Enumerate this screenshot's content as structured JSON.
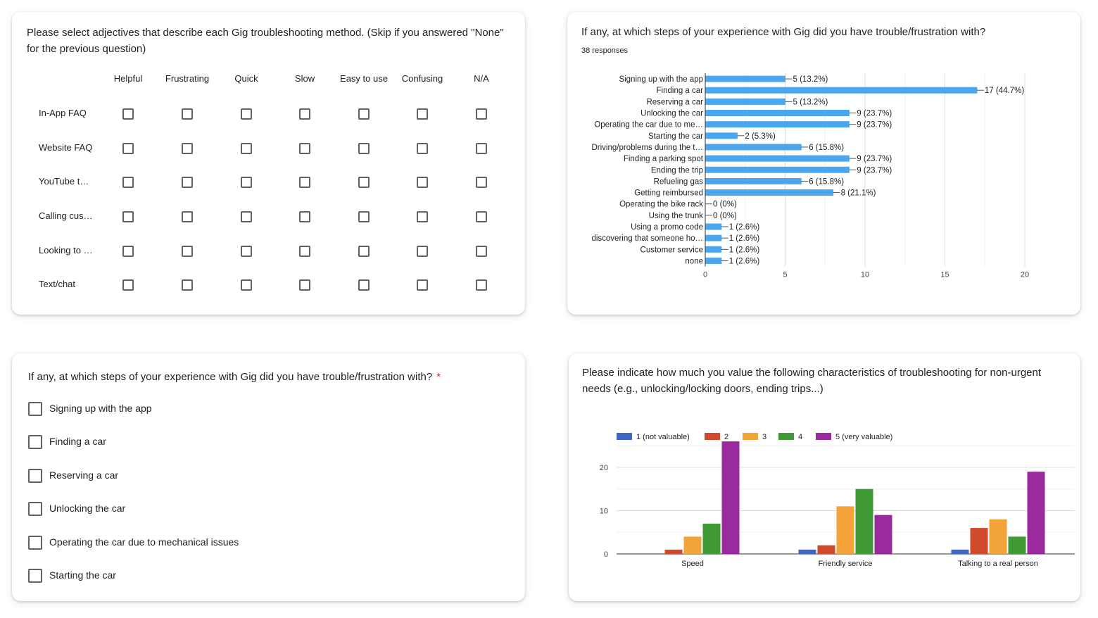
{
  "grid_question": {
    "title": "Please select adjectives that describe each Gig troubleshooting method. (Skip if you answered \"None\" for the previous question)",
    "columns": [
      "Helpful",
      "Frustrating",
      "Quick",
      "Slow",
      "Easy to use",
      "Confusing",
      "N/A"
    ],
    "rows": [
      "In-App FAQ",
      "Website FAQ",
      "YouTube t…",
      "Calling cus…",
      "Looking to …",
      "Text/chat"
    ]
  },
  "bar_question": {
    "title": "If any, at which steps of your experience with Gig did you have trouble/frustration with?",
    "responses": "38 responses"
  },
  "checkbox_question": {
    "title": "If any, at which steps of your experience with Gig did you have trouble/frustration with?",
    "required_mark": "*",
    "options": [
      "Signing up with the app",
      "Finding a car",
      "Reserving a car",
      "Unlocking the car",
      "Operating the car due to mechanical issues",
      "Starting the car"
    ]
  },
  "column_question": {
    "title": "Please indicate how much you value the following characteristics of troubleshooting for non-urgent needs (e.g., unlocking/locking doors, ending trips...)"
  },
  "chart_data": [
    {
      "type": "bar",
      "orientation": "horizontal",
      "categories": [
        "Signing up with the app",
        "Finding a car",
        "Reserving a car",
        "Unlocking the car",
        "Operating the car due to me…",
        "Starting the car",
        "Driving/problems during the t…",
        "Finding a parking spot",
        "Ending the trip",
        "Refueling gas",
        "Getting reimbursed",
        "Operating the bike rack",
        "Using the trunk",
        "Using a promo code",
        "discovering that someone ho…",
        "Customer service",
        "none"
      ],
      "values": [
        5,
        17,
        5,
        9,
        9,
        2,
        6,
        9,
        9,
        6,
        8,
        0,
        0,
        1,
        1,
        1,
        1
      ],
      "data_labels": [
        "5 (13.2%)",
        "17 (44.7%)",
        "5 (13.2%)",
        "9 (23.7%)",
        "9 (23.7%)",
        "2 (5.3%)",
        "6 (15.8%)",
        "9 (23.7%)",
        "9 (23.7%)",
        "6 (15.8%)",
        "8 (21.1%)",
        "0 (0%)",
        "0 (0%)",
        "1 (2.6%)",
        "1 (2.6%)",
        "1 (2.6%)",
        "1 (2.6%)"
      ],
      "xlim": [
        0,
        20
      ],
      "xticks": [
        "0",
        "5",
        "10",
        "15",
        "20"
      ],
      "color": "#4ba6ee",
      "grid": true
    },
    {
      "type": "bar",
      "categories": [
        "Speed",
        "Friendly service",
        "Talking to a real person"
      ],
      "series": [
        {
          "name": "1 (not valuable)",
          "color": "#3f66c7",
          "values": [
            0,
            1,
            1
          ]
        },
        {
          "name": "2",
          "color": "#d1492b",
          "values": [
            1,
            2,
            6
          ]
        },
        {
          "name": "3",
          "color": "#f2a33a",
          "values": [
            4,
            11,
            8
          ]
        },
        {
          "name": "4",
          "color": "#3f9a36",
          "values": [
            7,
            15,
            4
          ]
        },
        {
          "name": "5 (very valuable)",
          "color": "#9b2a9e",
          "values": [
            26,
            9,
            19
          ]
        }
      ],
      "ylim": [
        0,
        25
      ],
      "yticks": [
        "0",
        "10",
        "20"
      ],
      "legend_position": "top-left",
      "grid": true
    }
  ]
}
